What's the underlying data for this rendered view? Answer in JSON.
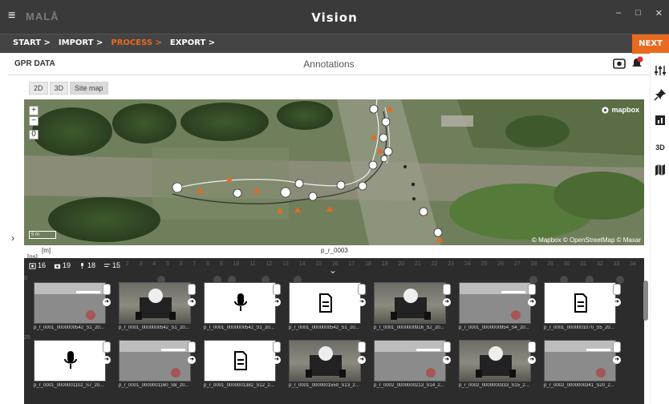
{
  "window": {
    "menu_glyph": "≡",
    "brand": "MALÅ",
    "title": "Vision",
    "minimize": "–",
    "maximize": "□",
    "close": "✕"
  },
  "steps": [
    {
      "label": "START >",
      "active": false
    },
    {
      "label": "IMPORT >",
      "active": false
    },
    {
      "label": "PROCESS >",
      "active": true
    },
    {
      "label": "EXPORT >",
      "active": false
    }
  ],
  "next_label": "NEXT >>",
  "subheader": {
    "left": "GPR DATA",
    "center": "Annotations"
  },
  "view_tabs": [
    "2D",
    "3D",
    "Site map"
  ],
  "map": {
    "zoom_in": "+",
    "zoom_out": "−",
    "reset": "0",
    "logo": "mapbox",
    "scale_label": "5 m",
    "attribution": "© Mapbox © OpenStreetMap © Maxar"
  },
  "axis": {
    "unit": "[m]",
    "time_unit": "[ns]",
    "profile": "p_r_0003"
  },
  "counts": {
    "photo_all": "16",
    "camera": "19",
    "voice": "18",
    "text": "15"
  },
  "ruler_ticks": [
    "1",
    "2",
    "3",
    "4",
    "5",
    "6",
    "7",
    "8",
    "9",
    "10",
    "11",
    "12",
    "13",
    "14",
    "15",
    "16",
    "17",
    "18",
    "19",
    "20",
    "21",
    "22",
    "23",
    "24",
    "25",
    "26",
    "27",
    "28",
    "29",
    "30",
    "31",
    "32",
    "33",
    "34"
  ],
  "y_scale": [
    "0",
    "25"
  ],
  "thumbnails": [
    {
      "type": "radar",
      "label": "p_r_0001_0000000542_S1_20..."
    },
    {
      "type": "photo",
      "label": "p_r_0001_0000000542_S1_20..."
    },
    {
      "type": "voice",
      "label": "p_r_0001_0000000542_S1_20..."
    },
    {
      "type": "text",
      "label": "p_r_0001_0000000542_S1_20..."
    },
    {
      "type": "photo",
      "label": "p_r_0001_0000000916_S2_20..."
    },
    {
      "type": "radar",
      "label": "p_r_0001_0000000954_S4_20..."
    },
    {
      "type": "text",
      "label": "p_r_0001_0000001070_S5_20..."
    },
    {
      "type": "voice",
      "label": "p_r_0001_0000001102_S7_20..."
    },
    {
      "type": "radar",
      "label": "p_r_0001_0000001160_S8_20..."
    },
    {
      "type": "text",
      "label": "p_r_0001_0000001382_S12_2..."
    },
    {
      "type": "photo",
      "label": "p_r_0001_0000001550_S13_2..."
    },
    {
      "type": "radar",
      "label": "p_r_0002_0000000213_S14_2..."
    },
    {
      "type": "photo",
      "label": "p_r_0002_0000000333_S15_2..."
    },
    {
      "type": "radar",
      "label": "p_r_0002_0000000341_S20_2..."
    }
  ],
  "colors": {
    "accent": "#e86a1e",
    "titlebar": "#3a3a3a",
    "panel": "#2c2c2c"
  }
}
